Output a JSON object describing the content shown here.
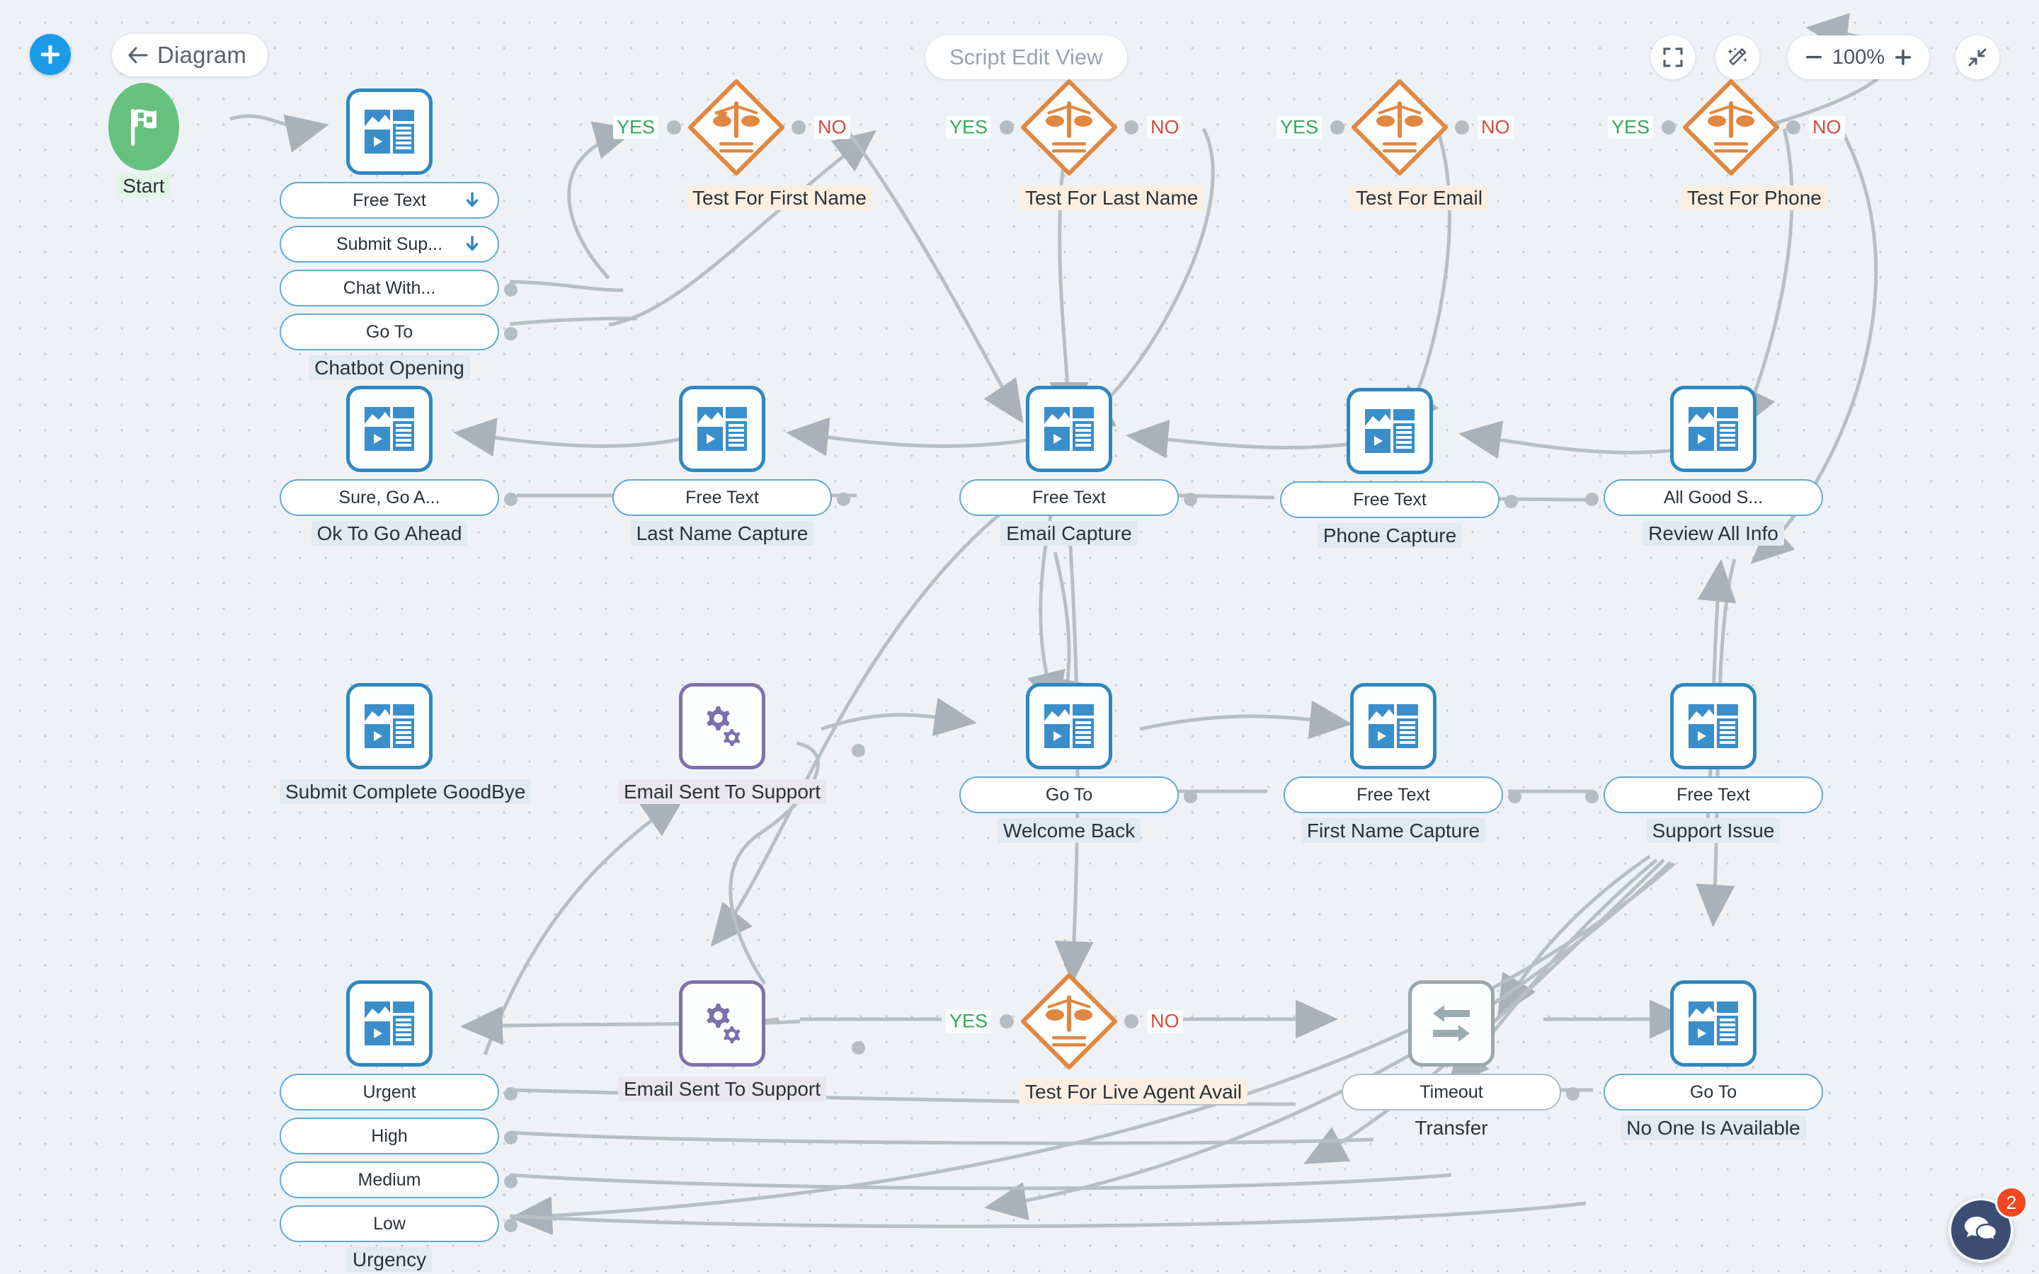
{
  "toolbar": {
    "add_label": "plus-icon",
    "back_label": "Diagram",
    "script_view_label": "Script Edit View",
    "fit_icon": "fit-screen-icon",
    "magic_icon": "magic-wand-icon",
    "zoom_out_label": "−",
    "zoom_value": "100%",
    "zoom_in_label": "+",
    "shrink_icon": "collapse-icon"
  },
  "chat_widget": {
    "badge_count": "2",
    "icon": "chat-bubbles-icon"
  },
  "nodes": {
    "start": {
      "label": "Start"
    },
    "chatbot_opening": {
      "label": "Chatbot Opening",
      "pills": [
        "Free Text",
        "Submit Sup...",
        "Chat With...",
        "Go To"
      ]
    },
    "test_first_name": {
      "label": "Test For First Name",
      "yes": "YES",
      "no": "NO"
    },
    "test_last_name": {
      "label": "Test For Last Name",
      "yes": "YES",
      "no": "NO"
    },
    "test_email": {
      "label": "Test For Email",
      "yes": "YES",
      "no": "NO"
    },
    "test_phone": {
      "label": "Test For Phone",
      "yes": "YES",
      "no": "NO"
    },
    "ok_to_go_ahead": {
      "label": "Ok To Go Ahead",
      "pills": [
        "Sure, Go A..."
      ]
    },
    "last_name_capture": {
      "label": "Last Name Capture",
      "pills": [
        "Free Text"
      ]
    },
    "email_capture": {
      "label": "Email Capture",
      "pills": [
        "Free Text"
      ]
    },
    "phone_capture": {
      "label": "Phone Capture",
      "pills": [
        "Free Text"
      ]
    },
    "review_all_info": {
      "label": "Review All Info",
      "pills": [
        "All Good S..."
      ]
    },
    "submit_complete_goodbye": {
      "label": "Submit Complete GoodBye",
      "pills": []
    },
    "email_sent_to_support_1": {
      "label": "Email Sent To Support",
      "pills": []
    },
    "welcome_back": {
      "label": "Welcome Back",
      "pills": [
        "Go To"
      ]
    },
    "first_name_capture": {
      "label": "First Name Capture",
      "pills": [
        "Free Text"
      ]
    },
    "support_issue": {
      "label": "Support Issue",
      "pills": [
        "Free Text"
      ]
    },
    "urgency": {
      "label": "Urgency",
      "pills": [
        "Urgent",
        "High",
        "Medium",
        "Low"
      ]
    },
    "email_sent_to_support_2": {
      "label": "Email Sent To Support",
      "pills": []
    },
    "test_live_agent": {
      "label": "Test For Live Agent Avail",
      "yes": "YES",
      "no": "NO"
    },
    "transfer": {
      "label": "Transfer",
      "pills": [
        "Timeout"
      ]
    },
    "no_one_is_available": {
      "label": "No One Is Available",
      "pills": [
        "Go To"
      ]
    }
  },
  "colors": {
    "message_node": "#2f87bf",
    "decision_node": "#e08741",
    "action_node": "#8071ac",
    "transfer_node": "#9aa8ae",
    "start_node": "#67c17e",
    "yes": "#37a85a",
    "no": "#d94a3d",
    "accent": "#1b9ae8",
    "badge": "#f4471f",
    "canvas_bg": "#eef2f6"
  }
}
